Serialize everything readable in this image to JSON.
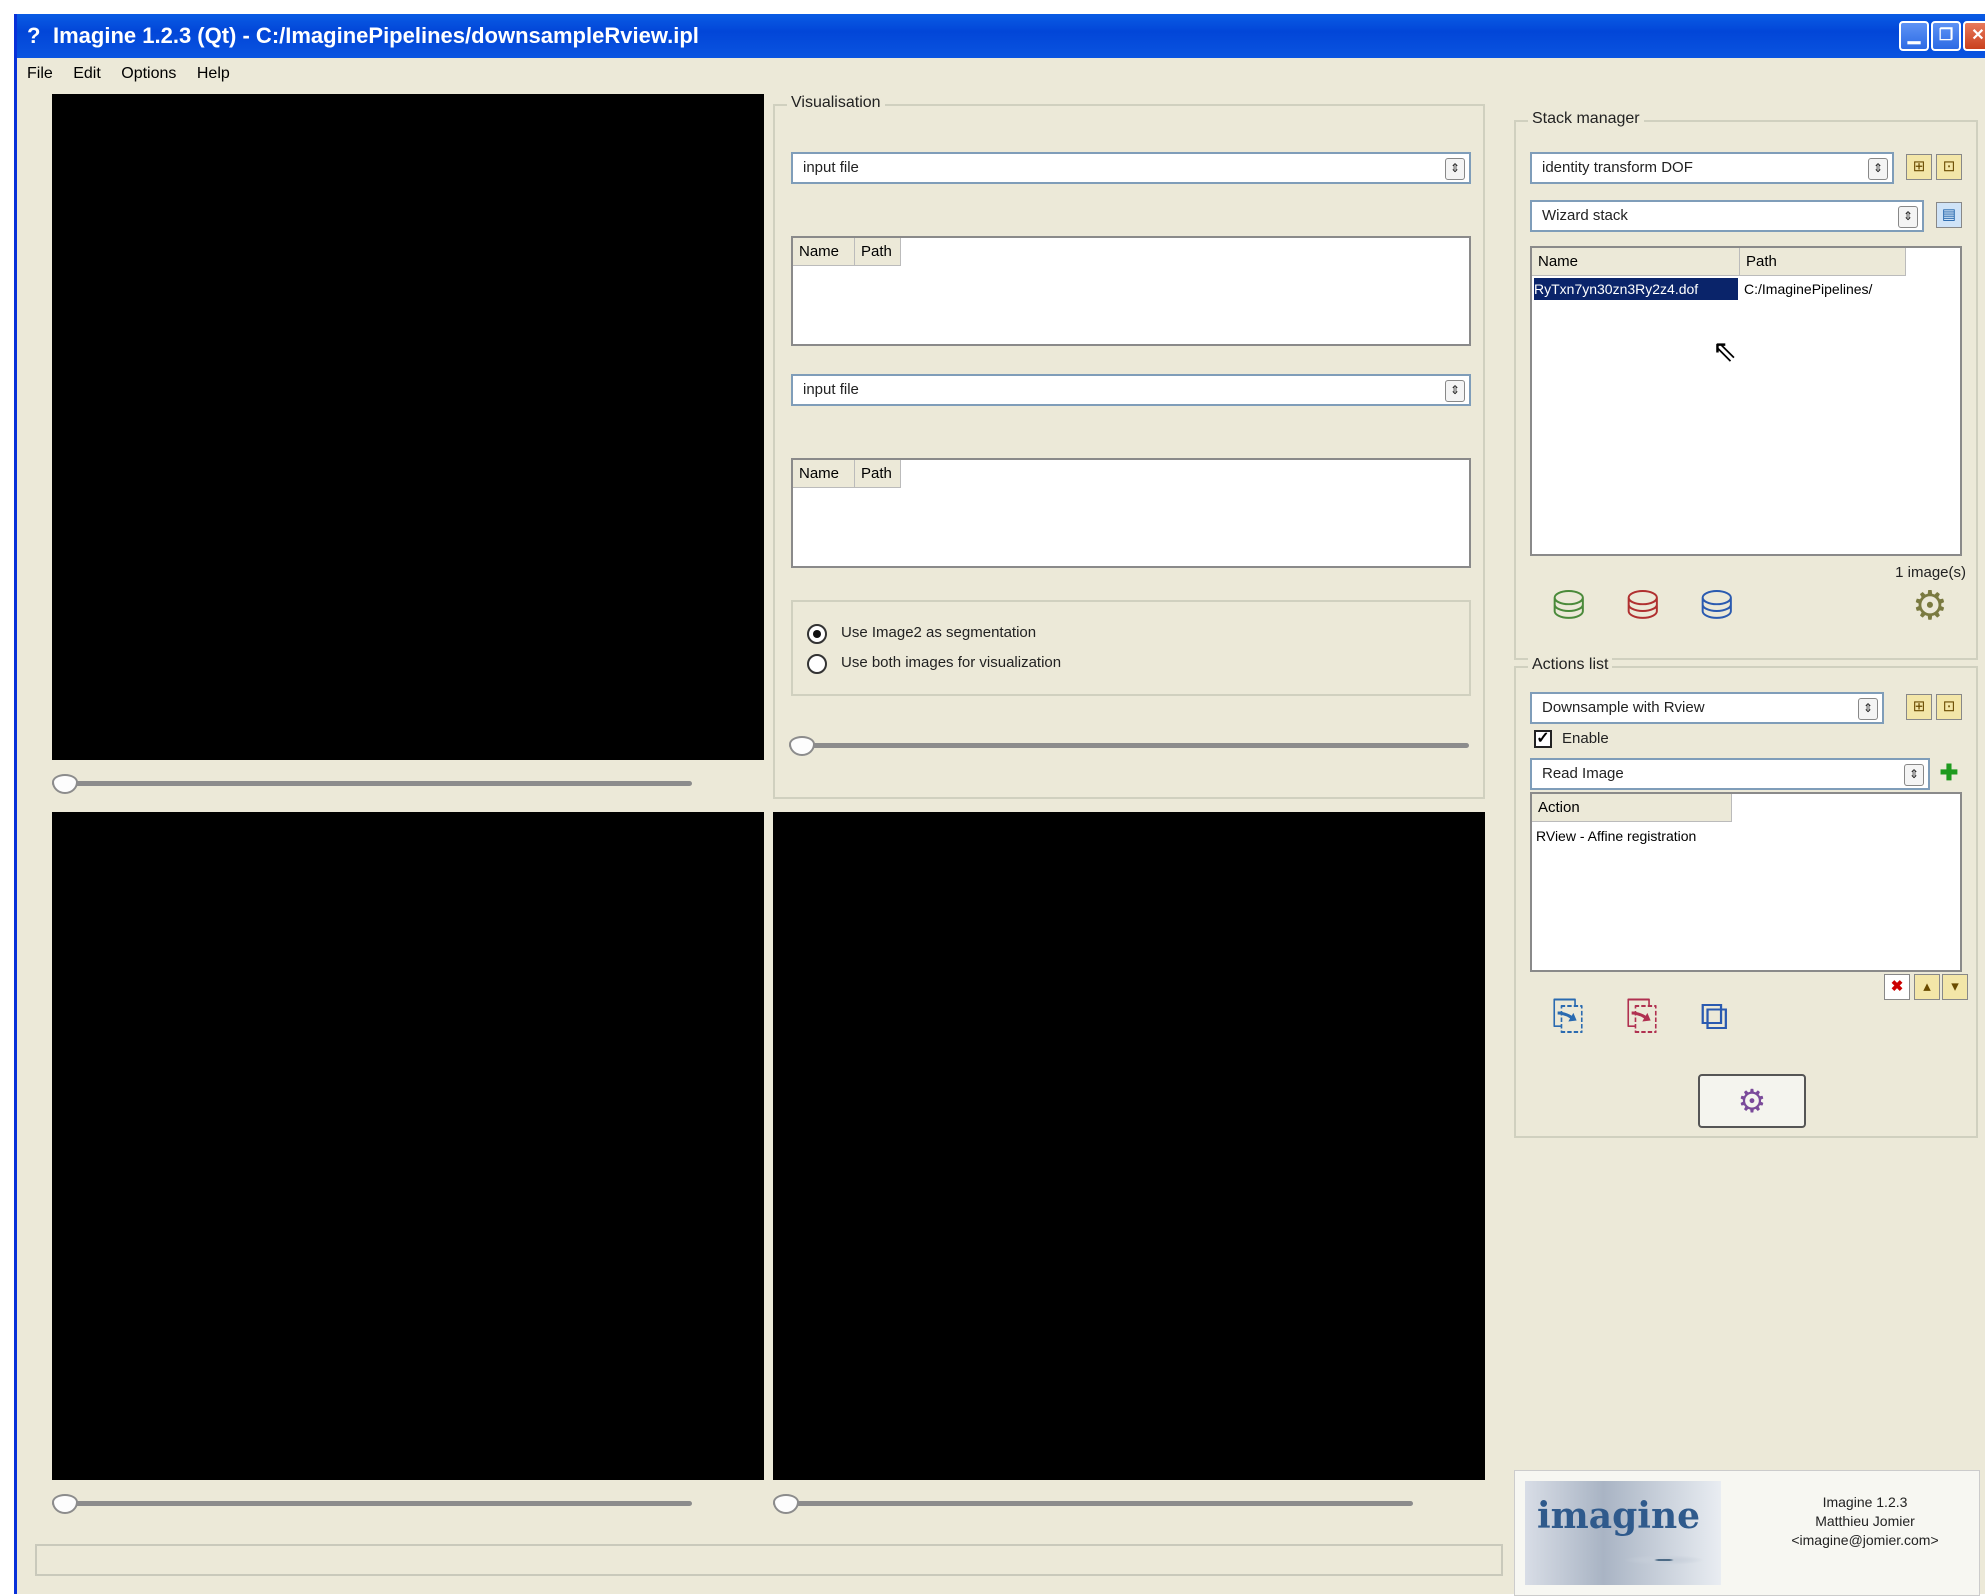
{
  "window": {
    "app_icon": "?",
    "title": "Imagine 1.2.3 (Qt) - C:/ImaginePipelines/downsampleRview.ipl",
    "minimize_icon": "minimize-icon",
    "restore_icon": "restore-icon",
    "close_icon": "close-icon"
  },
  "menu": [
    "File",
    "Edit",
    "Options",
    "Help"
  ],
  "visualisation": {
    "title": "Visualisation",
    "combo1": "input file",
    "combo2": "input file",
    "table_headers": [
      "Name",
      "Path"
    ],
    "radio1": "Use Image2 as segmentation",
    "radio2": "Use both images for visualization",
    "selected_radio": 1
  },
  "stack_manager": {
    "title": "Stack manager",
    "combo1": "identity transform DOF",
    "combo2": "Wizard stack",
    "headers": [
      "Name",
      "Path"
    ],
    "rows": [
      {
        "name": "RyTxn7yn30zn3Ry2z4.dof",
        "path": "C:/ImaginePipelines/"
      }
    ],
    "count": "1 image(s)",
    "icons": [
      "add-image-icon",
      "remove-image-icon",
      "refresh-image-icon",
      "wizard-icon"
    ]
  },
  "actions": {
    "title": "Actions list",
    "combo1": "Downsample with Rview",
    "enable_label": "Enable",
    "enabled": true,
    "combo2": "Read Image",
    "header": "Action",
    "items": [
      "RView - Affine registration"
    ],
    "icons": [
      "add-action-icon",
      "edit-action-icon",
      "copy-action-icon"
    ],
    "run_icon": "run-pipeline-icon"
  },
  "about": {
    "logo_text": "imagine",
    "line1": "Imagine 1.2.3",
    "line2": "Matthieu Jomier",
    "line3": "<imagine@jomier.com>"
  }
}
